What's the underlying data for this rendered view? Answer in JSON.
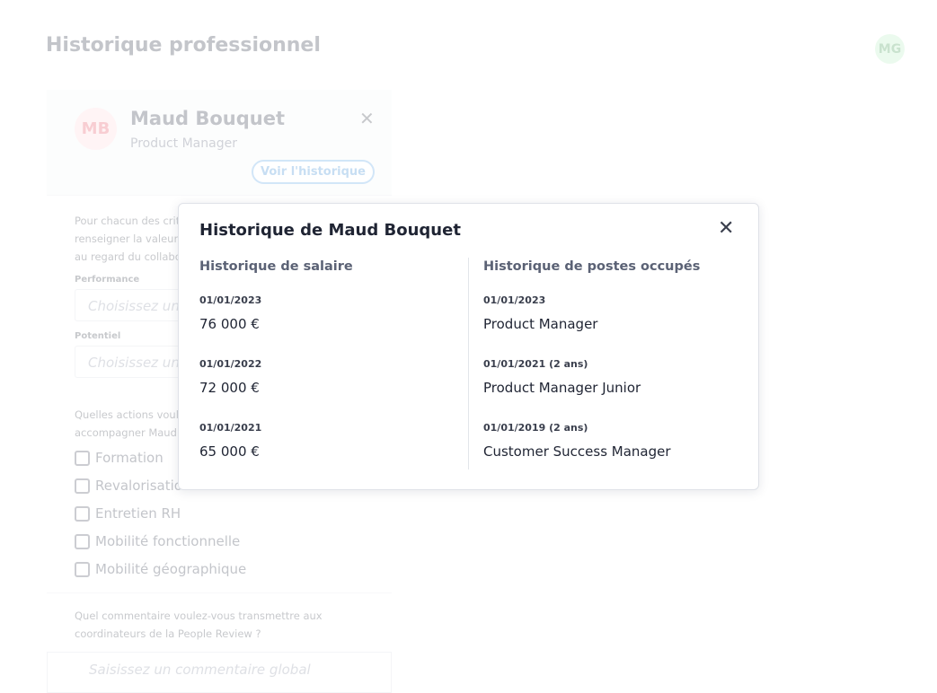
{
  "page": {
    "title": "Historique professionnel",
    "user_initials": "MG"
  },
  "employee": {
    "initials": "MB",
    "name": "Maud Bouquet",
    "role": "Product Manager",
    "history_button": "Voir l'historique"
  },
  "form": {
    "intro": "Pour chacun des critères ci-dessous, merci de renseigner la valeur que vous jugez la plus pertinente au regard du collaborateur.",
    "performance_label": "Performance",
    "performance_placeholder": "Choisissez une valeur",
    "potential_label": "Potentiel",
    "potential_placeholder": "Choisissez une valeur",
    "actions_question": "Quelles actions voulez-vous mettre en place pour accompagner Maud ?",
    "actions": [
      "Formation",
      "Revalorisation salariale",
      "Entretien RH",
      "Mobilité fonctionnelle",
      "Mobilité géographique"
    ],
    "comment_question": "Quel commentaire voulez-vous transmettre aux coordinateurs de la People Review ?",
    "comment_placeholder": "Saisissez un commentaire global"
  },
  "modal": {
    "title": "Historique de Maud Bouquet",
    "salary_title": "Historique de salaire",
    "salary": [
      {
        "date": "01/01/2023",
        "value": "76 000 €"
      },
      {
        "date": "01/01/2022",
        "value": "72 000 €"
      },
      {
        "date": "01/01/2021",
        "value": "65 000 €"
      }
    ],
    "positions_title": "Historique de postes occupés",
    "positions": [
      {
        "date": "01/01/2023",
        "value": "Product Manager"
      },
      {
        "date": "01/01/2021 (2 ans)",
        "value": "Product Manager Junior"
      },
      {
        "date": "01/01/2019 (2 ans)",
        "value": "Customer Success Manager"
      }
    ]
  }
}
